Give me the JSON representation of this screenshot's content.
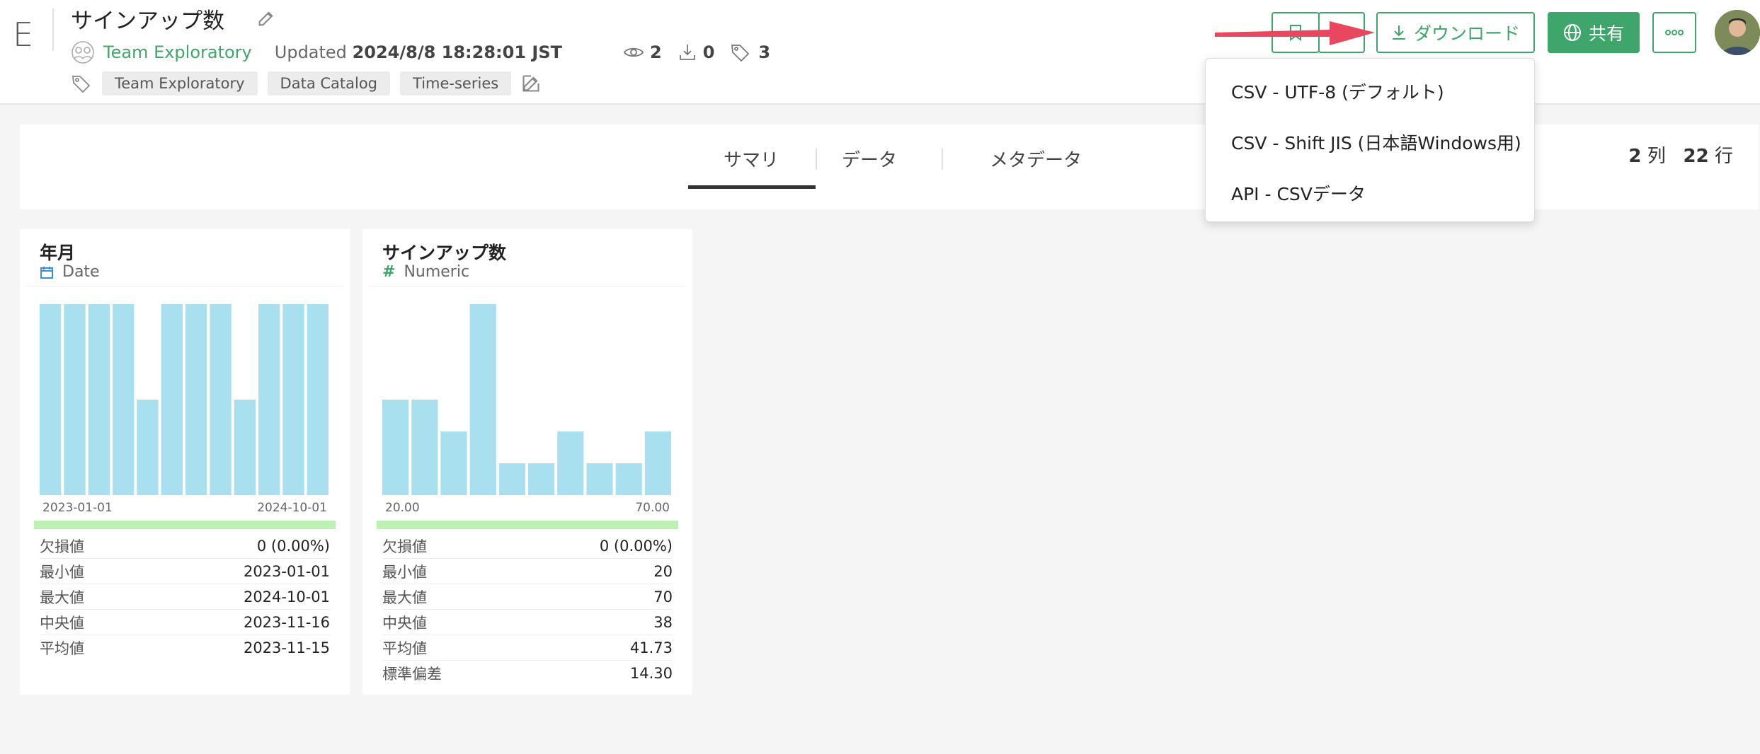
{
  "header": {
    "logo": "E",
    "title": "サインアップ数",
    "team": "Team Exploratory",
    "updated_prefix": "Updated",
    "updated_value": "2024/8/8 18:28:01 JST",
    "views": "2",
    "downloads": "0",
    "tag_count": "3",
    "tags": [
      "Team Exploratory",
      "Data Catalog",
      "Time-series"
    ],
    "download_label": "ダウンロード",
    "share_label": "共有",
    "more_label": "ooo"
  },
  "dropdown": {
    "items": [
      "CSV - UTF-8 (デフォルト)",
      "CSV - Shift JIS (日本語Windows用)",
      "API - CSVデータ"
    ]
  },
  "tabs": {
    "summary": "サマリ",
    "data": "データ",
    "metadata": "メタデータ",
    "cols_num": "2",
    "cols_unit": "列",
    "rows_num": "22",
    "rows_unit": "行"
  },
  "colors": {
    "accent": "#3ea66a",
    "bar": "#a8e0f0",
    "range": "#bdf1b4",
    "arrow": "#e8475f"
  },
  "cards": [
    {
      "title": "年月",
      "type_icon": "calendar-icon",
      "type_label": "Date",
      "axis_min": "2023-01-01",
      "axis_max": "2024-10-01",
      "stats": [
        {
          "k": "欠損値",
          "v": "0 (0.00%)"
        },
        {
          "k": "最小値",
          "v": "2023-01-01"
        },
        {
          "k": "最大値",
          "v": "2024-10-01"
        },
        {
          "k": "中央値",
          "v": "2023-11-16"
        },
        {
          "k": "平均値",
          "v": "2023-11-15"
        }
      ]
    },
    {
      "title": "サインアップ数",
      "type_icon": "hash-icon",
      "type_label": "Numeric",
      "axis_min": "20.00",
      "axis_max": "70.00",
      "stats": [
        {
          "k": "欠損値",
          "v": "0 (0.00%)"
        },
        {
          "k": "最小値",
          "v": "20"
        },
        {
          "k": "最大値",
          "v": "70"
        },
        {
          "k": "中央値",
          "v": "38"
        },
        {
          "k": "平均値",
          "v": "41.73"
        },
        {
          "k": "標準偏差",
          "v": "14.30"
        }
      ]
    }
  ],
  "chart_data": [
    {
      "type": "bar",
      "values": [
        2,
        2,
        2,
        2,
        1,
        2,
        2,
        2,
        1,
        2,
        2,
        2
      ]
    },
    {
      "type": "bar",
      "values": [
        3,
        3,
        2,
        6,
        1,
        1,
        2,
        1,
        1,
        2
      ]
    }
  ]
}
